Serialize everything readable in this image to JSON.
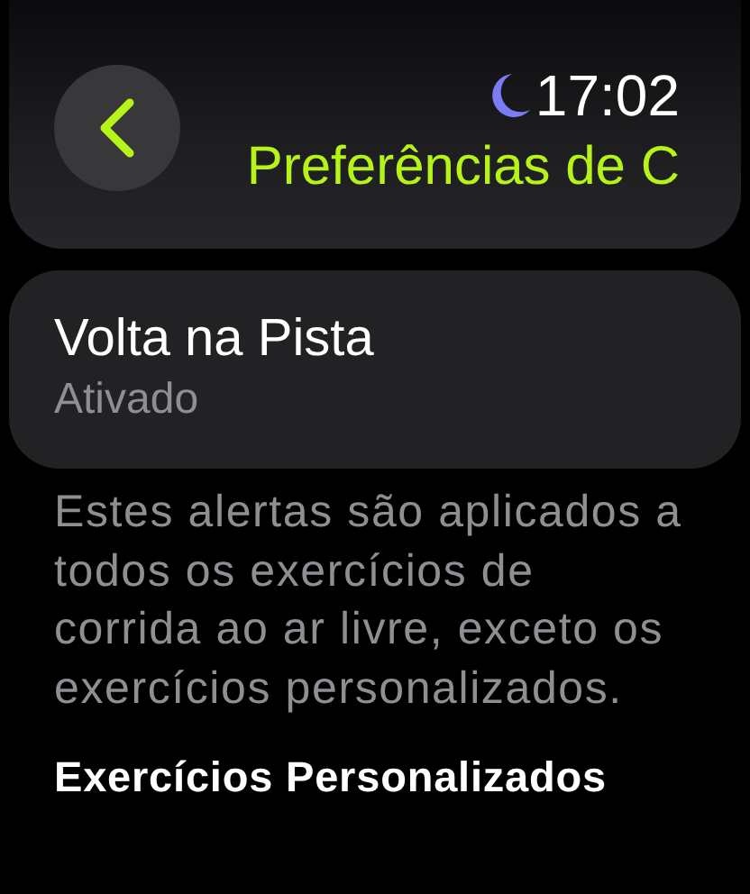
{
  "header": {
    "time": "17:02",
    "do_not_disturb": true,
    "title": "Preferências de C"
  },
  "setting": {
    "title": "Volta na Pista",
    "value": "Ativado"
  },
  "description": "Estes alertas são aplicados a todos os exercícios de corrida ao ar livre, exceto os exercícios personalizados.",
  "section_heading": "Exercícios Personalizados"
}
